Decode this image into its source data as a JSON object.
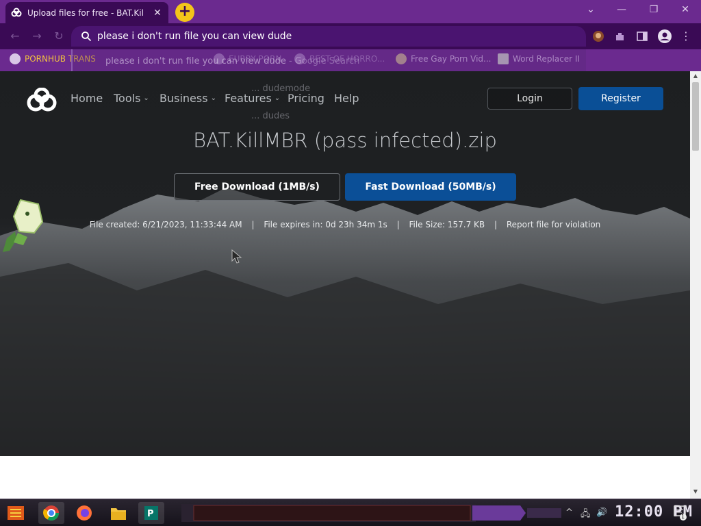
{
  "browser": {
    "tab_title": "Upload files for free - BAT.Kil",
    "tab_close": "✕",
    "new_tab": "+",
    "address_text": "please i don't run file you can view dude",
    "suggestion_text": "please i don't run file you can view dude",
    "suggestion_source": "- Google Search",
    "window_controls": {
      "dropdown": "⌄",
      "minimize": "—",
      "restore": "❐",
      "close": "✕"
    }
  },
  "bookmarks": [
    {
      "label": "PORNHUB TRANS",
      "icon": "globe-icon"
    },
    {
      "label": "EURRY PORN",
      "icon": "fox-icon"
    },
    {
      "label": "BEST OF HORRO...",
      "icon": "globe-icon"
    },
    {
      "label": "Free Gay Porn Vid...",
      "icon": "bear-icon"
    },
    {
      "label": "Word Replacer II",
      "icon": "wr-icon"
    }
  ],
  "site": {
    "nav": [
      {
        "label": "Home",
        "has_dropdown": false
      },
      {
        "label": "Tools",
        "has_dropdown": true
      },
      {
        "label": "Business",
        "has_dropdown": true
      },
      {
        "label": "Features",
        "has_dropdown": true
      },
      {
        "label": "Pricing",
        "has_dropdown": false
      },
      {
        "label": "Help",
        "has_dropdown": false
      }
    ],
    "dropdown_chevron": "⌄",
    "login_label": "Login",
    "register_label": "Register",
    "ghost_text_1": "... dudemode",
    "ghost_text_2": "... dudes",
    "file_name": "BAT.KillMBR (pass infected).zip",
    "free_download_label": "Free Download (1MB/s)",
    "fast_download_label": "Fast Download (50MB/s)",
    "meta": {
      "created": "File created: 6/21/2023, 11:33:44 AM",
      "expires": "File expires in: 0d 23h 34m 1s",
      "size": "File Size: 157.7 KB",
      "report": "Report file for violation",
      "separator": "|"
    },
    "colors": {
      "accent_blue": "#0b4f97",
      "browser_purple": "#6b2a8f",
      "toolbar_purple": "#3a0a55"
    }
  },
  "taskbar": {
    "clock": "12:00 PM",
    "apps": [
      "start-icon",
      "chrome-icon",
      "firefox-icon",
      "file-explorer-icon",
      "publisher-icon"
    ],
    "notification_count": "1"
  }
}
